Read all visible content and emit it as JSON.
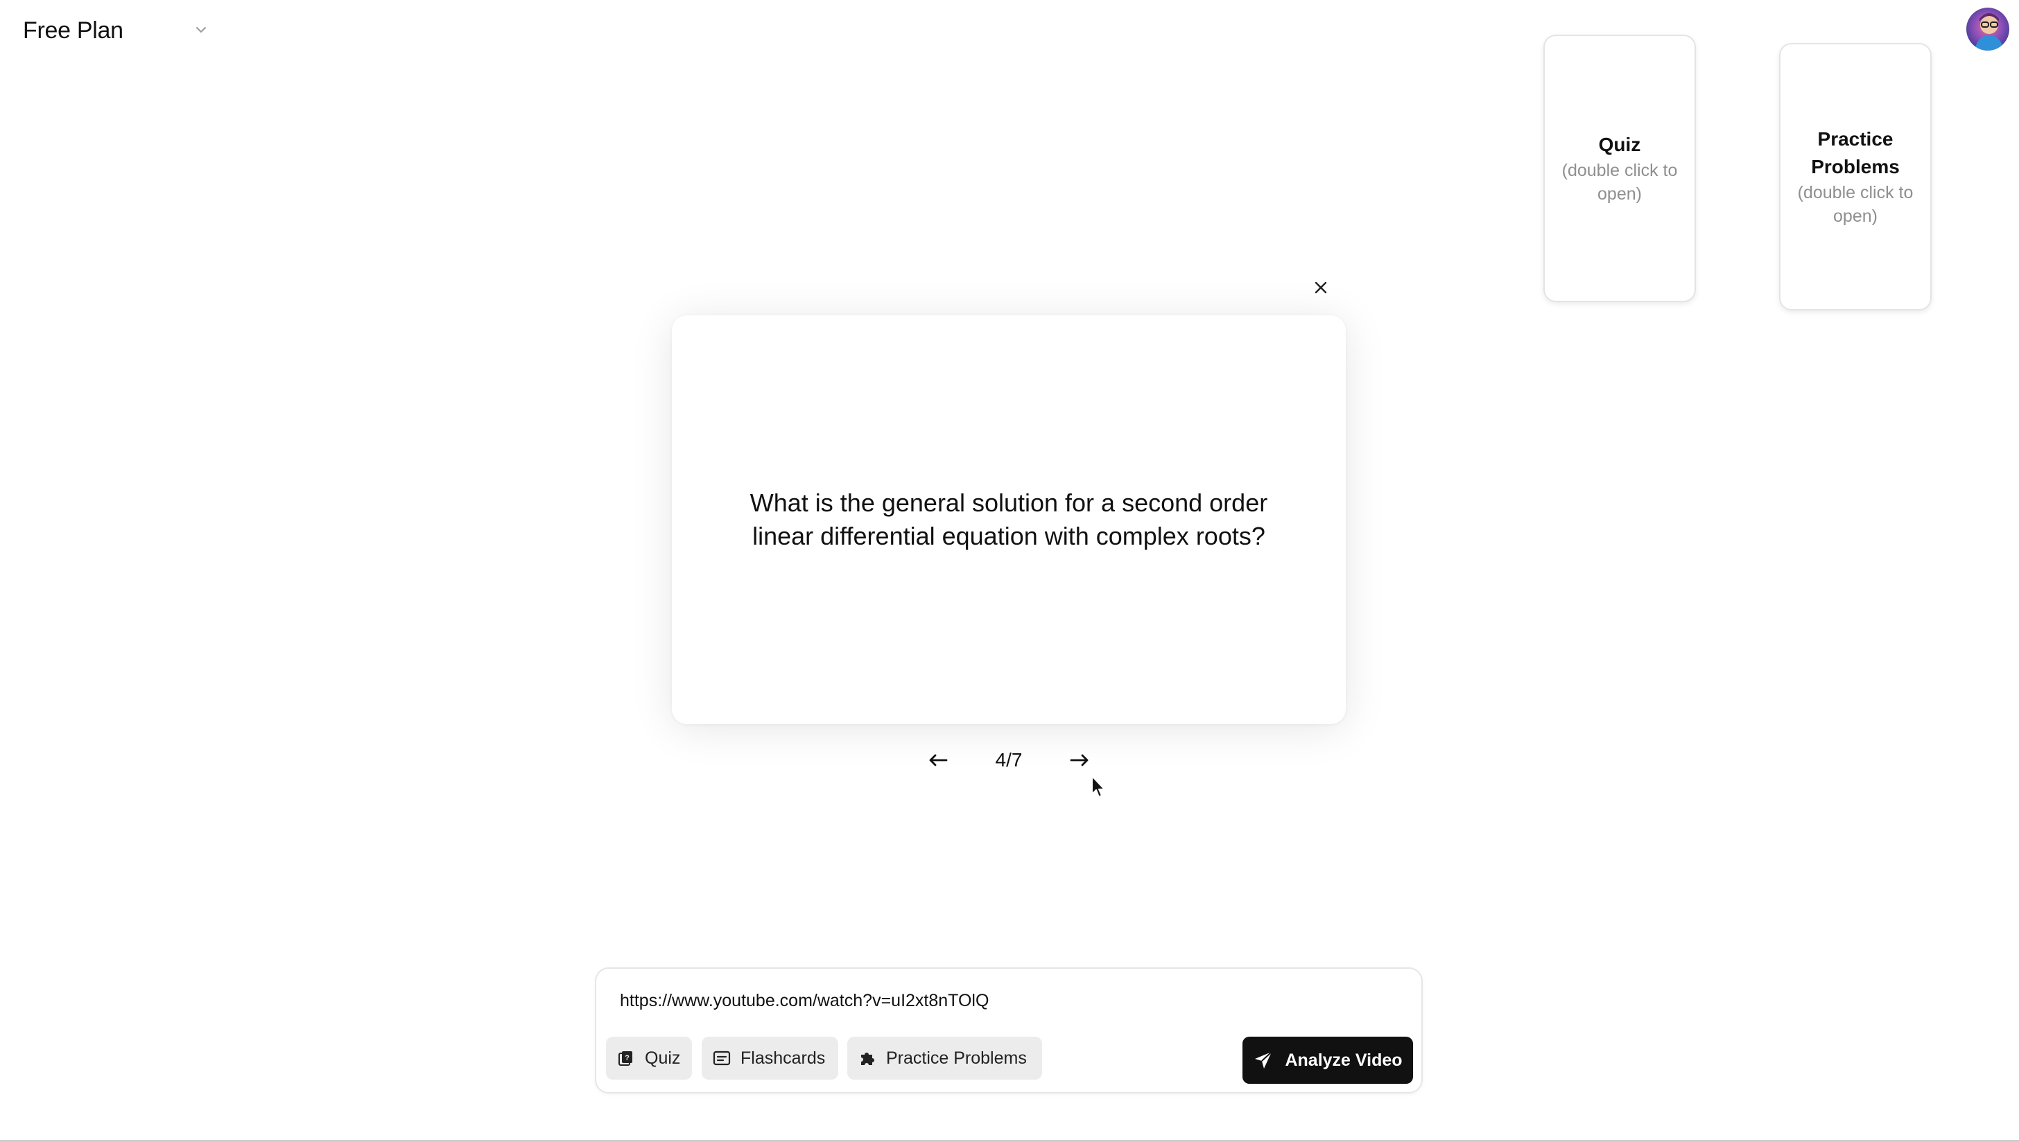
{
  "header": {
    "plan_label": "Free Plan"
  },
  "side_cards": {
    "quiz": {
      "title": "Quiz",
      "hint": "(double click to open)"
    },
    "practice": {
      "title": "Practice Problems",
      "hint": "(double click to open)"
    }
  },
  "flashcard": {
    "question": "What is the general solution for a second order linear differential equation with complex roots?",
    "counter": "4/7"
  },
  "input_panel": {
    "url_value": "https://www.youtube.com/watch?v=uI2xt8nTOlQ",
    "chips": {
      "quiz": "Quiz",
      "flashcards": "Flashcards",
      "practice": "Practice Problems"
    },
    "analyze_label": "Analyze Video"
  },
  "icons": {
    "chevron": "chevron-down-icon",
    "close": "close-icon",
    "prev": "arrow-left-icon",
    "next": "arrow-right-icon",
    "quiz": "quiz-icon",
    "flashcards": "flashcards-icon",
    "practice": "puzzle-icon",
    "analyze": "send-icon"
  },
  "colors": {
    "accent": "#111111",
    "chip_bg": "#ececec",
    "hint_text": "#8f8f8f"
  }
}
